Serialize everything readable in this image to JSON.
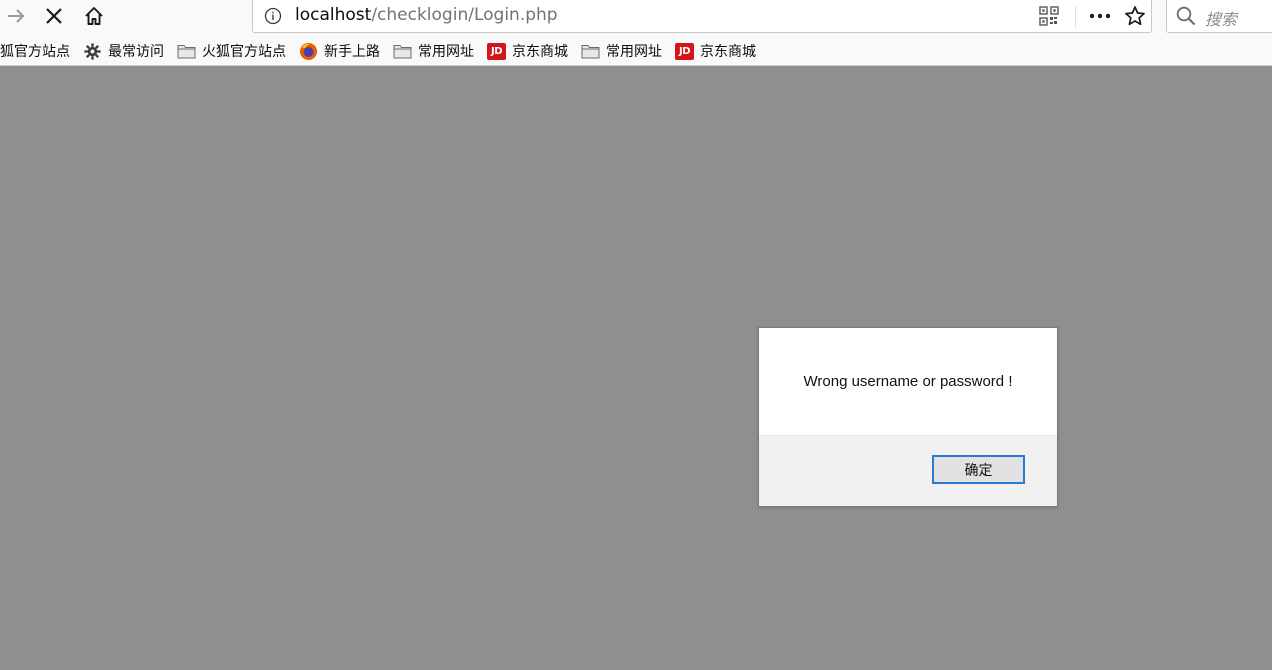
{
  "toolbar": {
    "forward_icon": "arrow-right-icon",
    "stop_icon": "close-icon",
    "home_icon": "home-icon"
  },
  "url_bar": {
    "host": "localhost",
    "path": "/checklogin/Login.php",
    "info_icon": "info-icon",
    "qr_icon": "qr-code-icon",
    "more_icon": "ellipsis-icon",
    "star_icon": "star-icon"
  },
  "search": {
    "placeholder": "搜索"
  },
  "bookmarks": [
    {
      "label": "火狐官方站点",
      "icon": "none"
    },
    {
      "label": "最常访问",
      "icon": "gear-icon"
    },
    {
      "label": "火狐官方站点",
      "icon": "folder-icon"
    },
    {
      "label": "新手上路",
      "icon": "firefox-icon"
    },
    {
      "label": "常用网址",
      "icon": "folder-icon"
    },
    {
      "label": "京东商城",
      "icon": "jd-icon"
    },
    {
      "label": "常用网址",
      "icon": "folder-icon"
    },
    {
      "label": "京东商城",
      "icon": "jd-icon"
    }
  ],
  "jd_badge_text": "JD",
  "alert": {
    "message": "Wrong username or password !",
    "ok_label": "确定"
  },
  "colors": {
    "page_background": "#8f8f8f",
    "jd_red": "#d3151c",
    "button_focus_border": "#2b7ad1"
  }
}
